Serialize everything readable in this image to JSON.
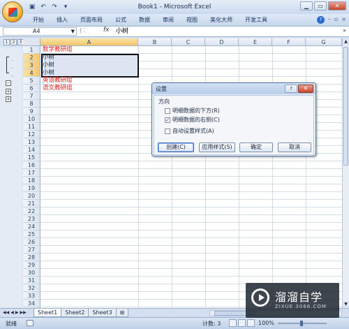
{
  "window": {
    "title": "Book1 - Microsoft Excel",
    "min": "▁",
    "max": "▭",
    "close": "✕"
  },
  "quick_access": {
    "save_icon": "save-icon",
    "undo_icon": "undo-icon",
    "redo_icon": "redo-icon",
    "customize": "▾"
  },
  "ribbon": {
    "tabs": [
      "开始",
      "插入",
      "页面布局",
      "公式",
      "数据",
      "审阅",
      "视图",
      "美化大师",
      "开发工具"
    ],
    "help": "?",
    "min": "–",
    "restore": "▫",
    "close": "×"
  },
  "formula_bar": {
    "name_box": "A4",
    "fx": "fx",
    "formula": "小树"
  },
  "outline": {
    "levels": [
      "1",
      "2",
      "3"
    ],
    "collapse": "−",
    "expand": "+"
  },
  "columns": [
    "A",
    "B",
    "C",
    "D",
    "E",
    "F",
    "G"
  ],
  "rows": [
    "1",
    "2",
    "3",
    "4",
    "5",
    "6",
    "7",
    "8",
    "9",
    "10",
    "11",
    "12",
    "13",
    "14",
    "15",
    "16",
    "17",
    "18",
    "19",
    "20",
    "21",
    "22",
    "23",
    "24",
    "25",
    "26",
    "27",
    "28",
    "29",
    "30",
    "31",
    "32",
    "33",
    "34",
    "35",
    "36",
    "37",
    "38"
  ],
  "cells": {
    "a1": "数学教研组",
    "a2": "小树",
    "a3": "小树",
    "a4": "小树",
    "a5": "英语教研组",
    "a9": "语文教研组"
  },
  "sheets": [
    "Sheet1",
    "Sheet2",
    "Sheet3"
  ],
  "sheet_nav": [
    "◀◀",
    "◀",
    "▶",
    "▶▶"
  ],
  "status": {
    "ready": "就绪",
    "count": "计数: 3",
    "zoom": "100%",
    "zoom_minus": "−"
  },
  "dialog": {
    "title": "设置",
    "help": "?",
    "close": "✕",
    "group_label": "方向",
    "options": [
      {
        "label": "明细数据的下方(R)",
        "checked": false
      },
      {
        "label": "明细数据的右侧(C)",
        "checked": true
      },
      {
        "label": "自动设置样式(A)",
        "checked": false
      }
    ],
    "buttons": {
      "create": "创建(C)",
      "apply": "应用样式(S)",
      "ok": "确定",
      "cancel": "取消"
    }
  },
  "watermark": {
    "text": "溜溜自学",
    "url": "ZIXUE.3066.COM"
  },
  "colors": {
    "red_text": "#e21d1d",
    "selection": "#dde4f2",
    "ribbon": "#c6d6ec"
  }
}
